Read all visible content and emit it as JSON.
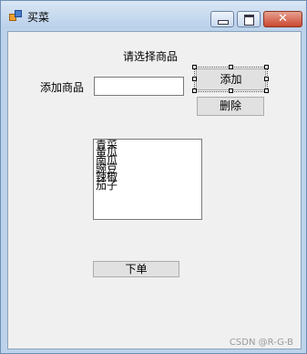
{
  "window": {
    "title": "买菜",
    "close_glyph": "✕"
  },
  "form": {
    "heading": "请选择商品",
    "add_label": "添加商品",
    "add_input_value": "",
    "add_button": "添加",
    "delete_button": "删除",
    "list_items": [
      "青菜",
      "黄瓜",
      "南瓜",
      "豌豆",
      "辣椒",
      "茄子"
    ],
    "order_button": "下单"
  },
  "watermark": "CSDN @R-G-B",
  "icons": {
    "app": "app-icon",
    "minimize": "minimize-icon",
    "maximize": "maximize-icon",
    "close": "close-icon"
  }
}
